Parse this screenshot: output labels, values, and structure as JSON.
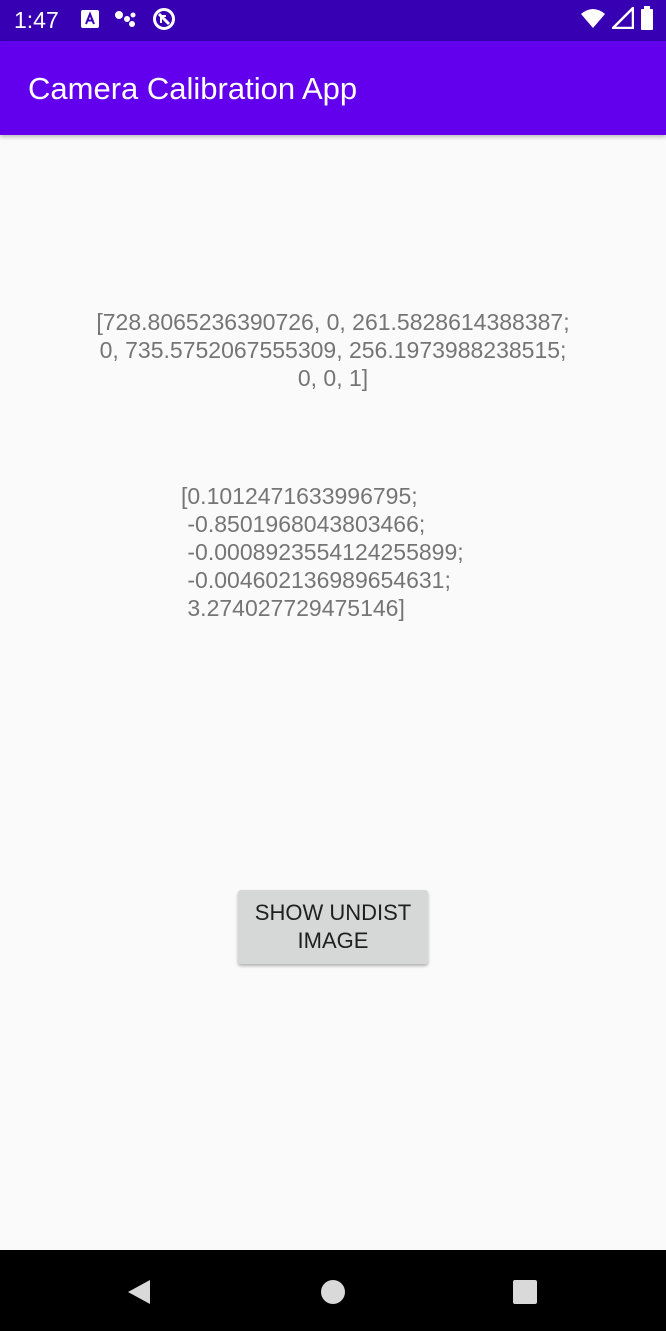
{
  "status_bar": {
    "time": "1:47",
    "left_icons": [
      "text-a-icon",
      "assistant-dots-icon",
      "no-sim-icon"
    ],
    "right_icons": [
      "wifi-icon",
      "cell-signal-icon",
      "battery-icon"
    ],
    "background": "#3700b3"
  },
  "app_bar": {
    "title": "Camera Calibration App",
    "background": "#6200ee"
  },
  "main": {
    "camera_matrix_lines": [
      "[728.8065236390726, 0, 261.5828614388387;",
      "0, 735.5752067555309, 256.1973988238515;",
      "0, 0, 1]"
    ],
    "distortion_lines": [
      "[0.1012471633996795;",
      " -0.8501968043803466;",
      " -0.0008923554124255899;",
      " -0.004602136989654631;",
      " 3.274027729475146]"
    ],
    "undist_button_label_line1": "SHOW UNDIST",
    "undist_button_label_line2": "IMAGE"
  },
  "nav_bar": {
    "buttons": [
      "back-icon",
      "home-icon",
      "recents-icon"
    ]
  }
}
